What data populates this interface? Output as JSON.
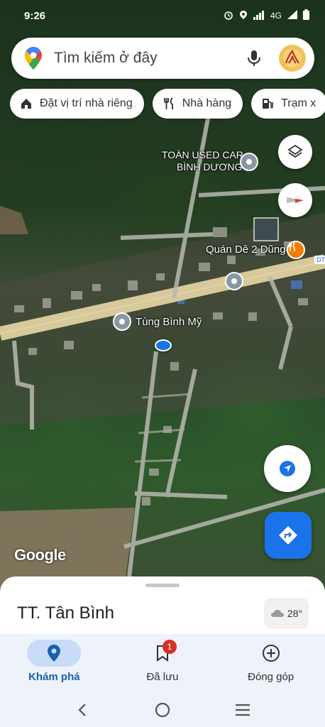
{
  "status_bar": {
    "time": "9:26",
    "network": "4G"
  },
  "search": {
    "placeholder": "Tìm kiếm ở đây"
  },
  "chips": [
    {
      "label": "Đặt vị trí nhà riêng",
      "icon": "home-icon"
    },
    {
      "label": "Nhà hàng",
      "icon": "restaurant-icon"
    },
    {
      "label": "Trạm x",
      "icon": "gas-station-icon"
    }
  ],
  "map": {
    "labels": {
      "used_car_line1": "TOÀN USED CAR",
      "used_car_line2": "BÌNH DƯƠNG",
      "quan_de": "Quán Dê 2 Dũng",
      "tung_binh_my": "Tùng Bình Mỹ",
      "road_tag": "DT"
    },
    "attribution": "Google",
    "colors": {
      "road": "#d8c99a",
      "location_dot": "#1a73e8",
      "restaurant_pin": "#f57c00",
      "poi_pin": "#8a97a3"
    }
  },
  "sheet": {
    "place_name": "TT. Tân Bình",
    "weather_temp": "28°",
    "weather_icon": "cloud-icon"
  },
  "bottom_nav": {
    "items": [
      {
        "label": "Khám phá",
        "icon": "explore-pin-icon",
        "active": true
      },
      {
        "label": "Đã lưu",
        "icon": "bookmark-icon",
        "badge": "1"
      },
      {
        "label": "Đóng góp",
        "icon": "add-circle-icon"
      }
    ],
    "active_color": "#1a5fb4"
  },
  "system_nav": [
    "back-icon",
    "home-circle-icon",
    "recents-icon"
  ]
}
